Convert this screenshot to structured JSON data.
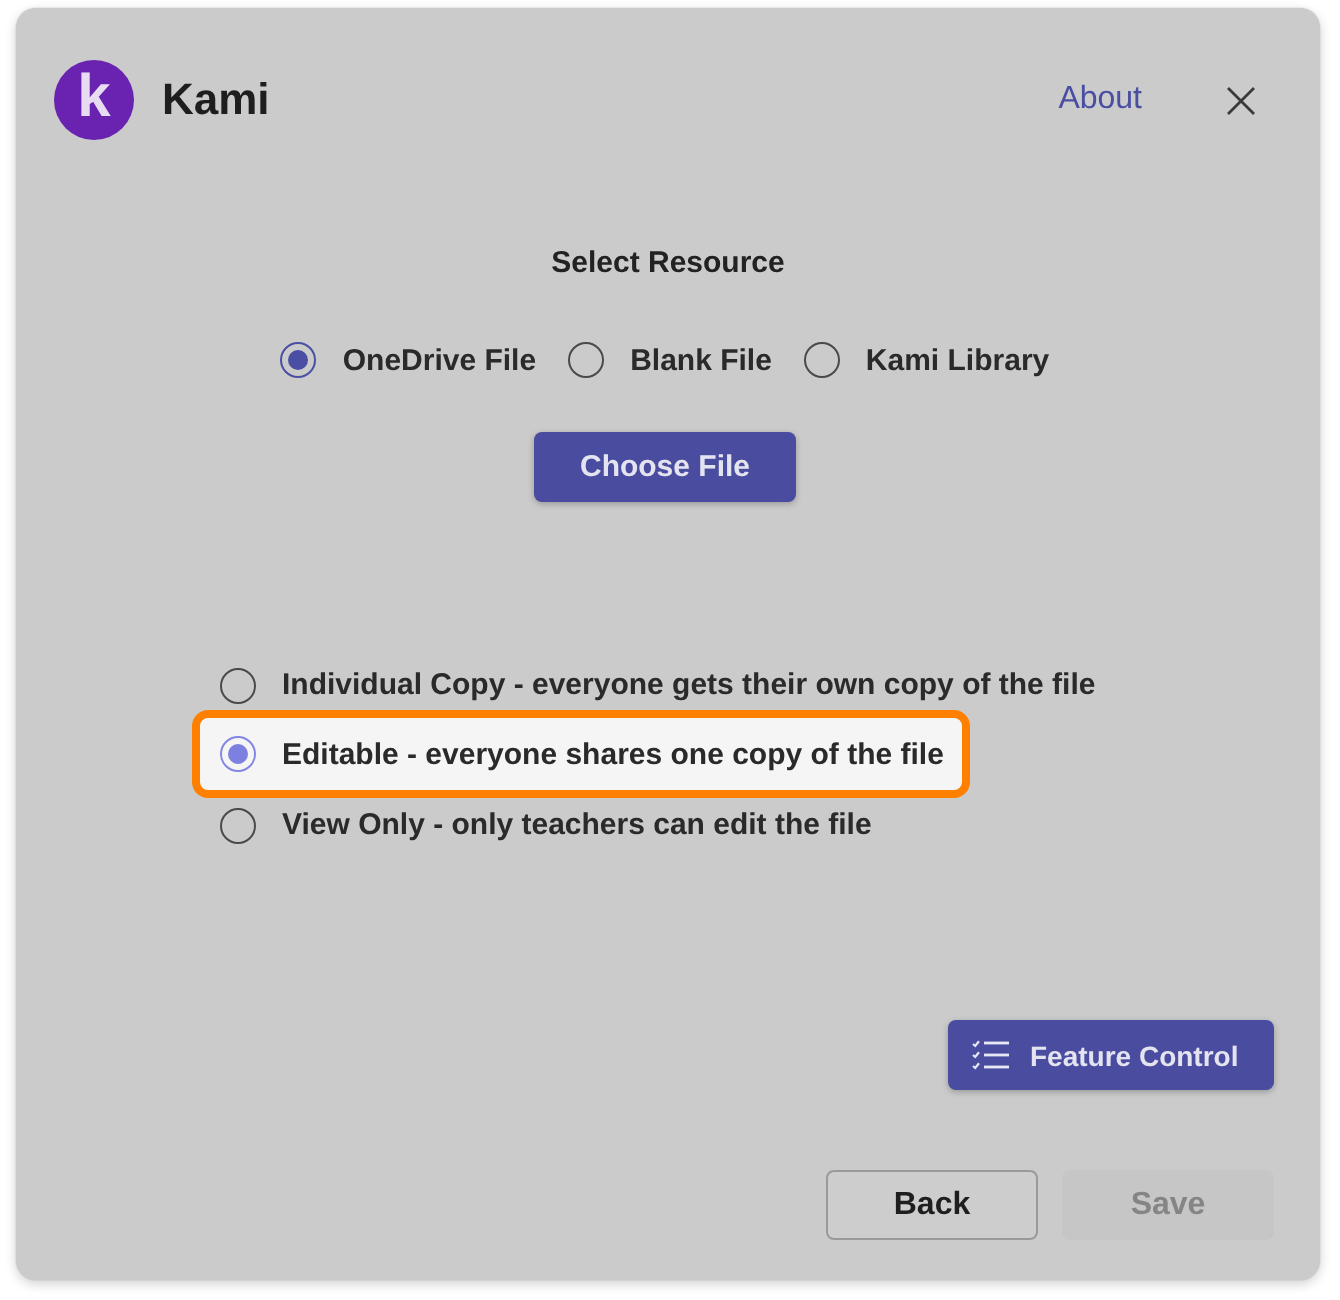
{
  "header": {
    "logo_letter": "k",
    "app_name": "Kami",
    "about_link": "About"
  },
  "resource": {
    "title": "Select Resource",
    "options": [
      {
        "label": "OneDrive File",
        "selected": true
      },
      {
        "label": "Blank File",
        "selected": false
      },
      {
        "label": "Kami Library",
        "selected": false
      }
    ],
    "choose_button": "Choose File"
  },
  "sharing": {
    "options": [
      {
        "label": "Individual Copy - everyone gets their own copy of the file",
        "selected": false,
        "highlighted": false
      },
      {
        "label": "Editable - everyone shares one copy of the file",
        "selected": true,
        "highlighted": true
      },
      {
        "label": "View Only - only teachers can edit the file",
        "selected": false,
        "highlighted": false
      }
    ]
  },
  "feature_button": "Feature Control",
  "footer": {
    "buttons": [
      {
        "label": "Back",
        "disabled": false
      },
      {
        "label": "Save",
        "disabled": true
      }
    ]
  }
}
